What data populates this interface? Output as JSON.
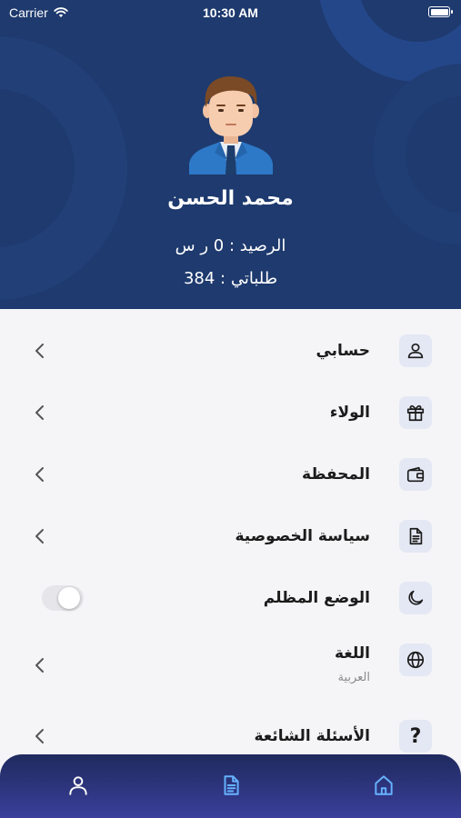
{
  "status_bar": {
    "carrier": "Carrier",
    "time": "10:30 AM"
  },
  "profile": {
    "name": "محمد الحسن",
    "balance": "الرصيد : 0 ر س",
    "orders": "طلباتي : 384"
  },
  "menu": {
    "items": [
      {
        "label": "حسابي",
        "icon": "user-icon",
        "type": "chevron"
      },
      {
        "label": "الولاء",
        "icon": "gift-icon",
        "type": "chevron"
      },
      {
        "label": "المحفظة",
        "icon": "wallet-icon",
        "type": "chevron"
      },
      {
        "label": "سياسة الخصوصية",
        "icon": "document-icon",
        "type": "chevron"
      },
      {
        "label": "الوضع المظلم",
        "icon": "moon-icon",
        "type": "toggle",
        "toggle_on": false
      },
      {
        "label": "اللغة",
        "sublabel": "العربية",
        "icon": "globe-icon",
        "type": "chevron"
      },
      {
        "label": "الأسئلة الشائعة",
        "icon": "question-icon",
        "type": "chevron"
      }
    ]
  },
  "tabbar": {
    "tabs": [
      {
        "icon": "profile-tab-icon"
      },
      {
        "icon": "orders-tab-icon"
      },
      {
        "icon": "home-tab-icon"
      }
    ]
  },
  "colors": {
    "header_bg": "#1e3a6e",
    "accent": "#1e3a6e",
    "icon_bg": "#e4e8f4",
    "tabbar_top": "#1f2a5e",
    "tabbar_bottom": "#3a3f9a",
    "tab_icon": "#66b2ff"
  }
}
